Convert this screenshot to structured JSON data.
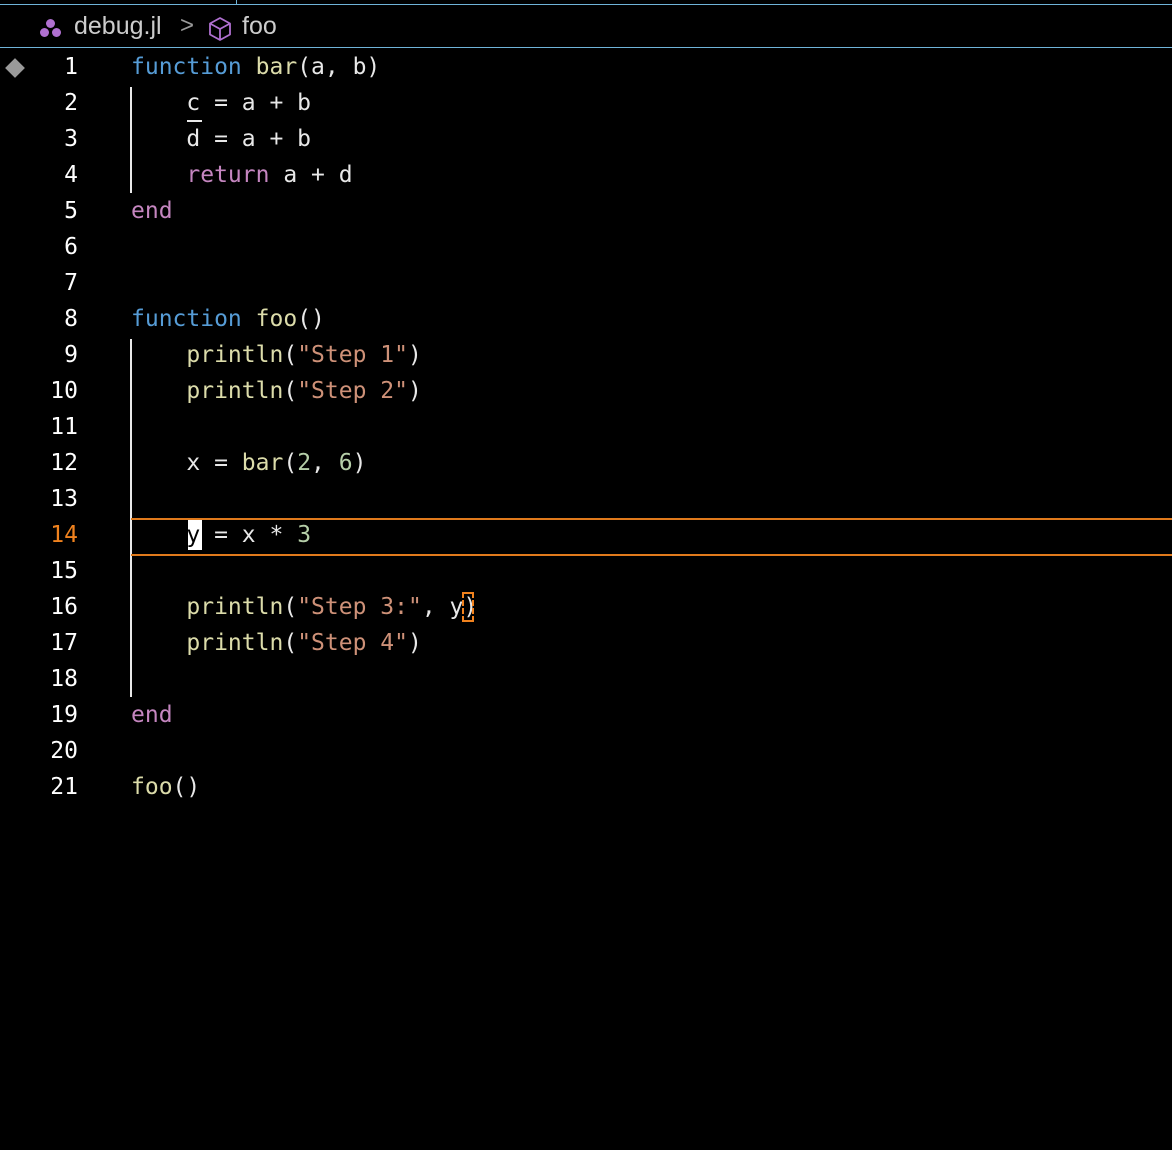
{
  "breadcrumb": {
    "file": "debug.jl",
    "file_icon": "julia-icon",
    "separator": ">",
    "symbol_icon": "cube-icon",
    "symbol": "foo"
  },
  "editor": {
    "current_line": 14,
    "line_numbers": [
      "1",
      "2",
      "3",
      "4",
      "5",
      "6",
      "7",
      "8",
      "9",
      "10",
      "11",
      "12",
      "13",
      "14",
      "15",
      "16",
      "17",
      "18",
      "19",
      "20",
      "21"
    ],
    "lines": [
      [
        "function",
        " ",
        "bar",
        "(a, b)"
      ],
      [
        "    ",
        "c",
        " = a + b"
      ],
      [
        "    ",
        "d",
        " = a + b"
      ],
      [
        "    ",
        "return",
        " a + d"
      ],
      [
        "end"
      ],
      [],
      [],
      [
        "function",
        " ",
        "foo",
        "()"
      ],
      [
        "    ",
        "println",
        "(",
        "\"Step 1\"",
        ")"
      ],
      [
        "    ",
        "println",
        "(",
        "\"Step 2\"",
        ")"
      ],
      [],
      [
        "    x = ",
        "bar",
        "(",
        "2",
        ", ",
        "6",
        ")"
      ],
      [],
      [
        "    ",
        "y",
        " = x * ",
        "3"
      ],
      [],
      [
        "    ",
        "println",
        "(",
        "\"Step 3:\"",
        ", ",
        "y",
        ")"
      ],
      [
        "    ",
        "println",
        "(",
        "\"Step 4\"",
        ")"
      ],
      [],
      [
        "end"
      ],
      [],
      [
        "foo",
        "()"
      ]
    ]
  },
  "colors": {
    "background": "#000000",
    "keyword_function": "#569cd6",
    "keyword_control": "#c586c0",
    "function_name": "#dcdcaa",
    "string": "#ce9178",
    "number": "#b5cea8",
    "current_line_accent": "#f0821e",
    "header_rule": "#6fb3d8"
  }
}
